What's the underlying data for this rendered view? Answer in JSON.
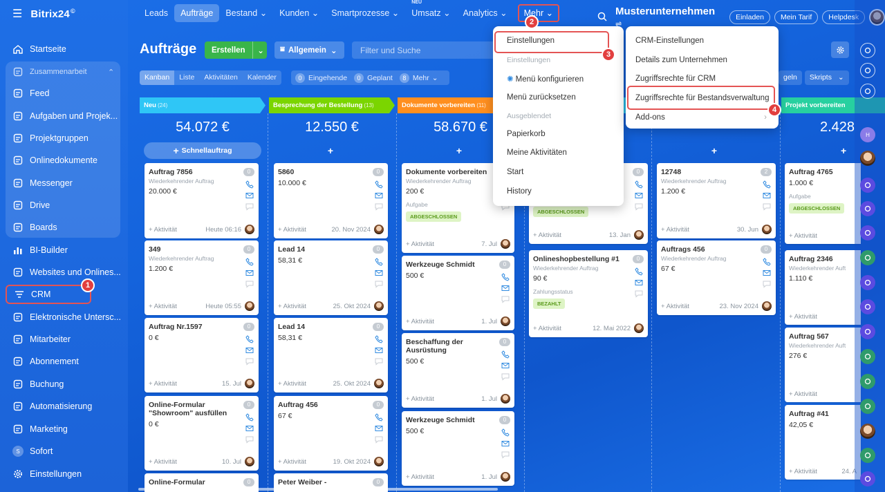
{
  "app": {
    "logo": "Bitrix24",
    "logo_mark": "©"
  },
  "sidebar": {
    "items": [
      {
        "label": "Startseite",
        "icon": "home-icon"
      },
      {
        "label": "Zusammenarbeit",
        "icon": "collab-icon"
      },
      {
        "label": "Feed",
        "icon": "feed-icon"
      },
      {
        "label": "Aufgaben und Projek...",
        "icon": "tasks-icon"
      },
      {
        "label": "Projektgruppen",
        "icon": "groups-icon"
      },
      {
        "label": "Onlinedokumente",
        "icon": "document-icon"
      },
      {
        "label": "Messenger",
        "icon": "chat-icon"
      },
      {
        "label": "Drive",
        "icon": "drive-icon"
      },
      {
        "label": "Boards",
        "icon": "boards-icon"
      },
      {
        "label": "BI-Builder",
        "icon": "chart-icon"
      },
      {
        "label": "Websites und Onlines...",
        "icon": "globe-icon"
      },
      {
        "label": "CRM",
        "icon": "crm-icon"
      },
      {
        "label": "Elektronische Untersc...",
        "icon": "signature-icon"
      },
      {
        "label": "Mitarbeiter",
        "icon": "employees-icon"
      },
      {
        "label": "Abonnement",
        "icon": "subscription-icon"
      },
      {
        "label": "Buchung",
        "icon": "calendar-icon"
      },
      {
        "label": "Automatisierung",
        "icon": "automation-icon"
      },
      {
        "label": "Marketing",
        "icon": "marketing-icon"
      },
      {
        "label": "Sofort",
        "icon": "sofort-icon",
        "icon_letter": "S"
      },
      {
        "label": "Einstellungen",
        "icon": "gear-icon"
      }
    ]
  },
  "topnav": {
    "items": [
      "Leads",
      "Aufträge",
      "Bestand",
      "Kunden",
      "Smartprozesse",
      "Umsatz",
      "Analytics"
    ],
    "new_badge": "NEU",
    "mehr": "Mehr",
    "company": "Musterunternehmen",
    "invite": "Einladen",
    "tariff": "Mein Tarif",
    "helpdesk": "Helpdesk"
  },
  "toolbar": {
    "title": "Aufträge",
    "create": "Erstellen",
    "category": "Allgemein",
    "filter_placeholder": "Filter und Suche"
  },
  "viewbar": {
    "views": [
      "Kanban",
      "Liste",
      "Aktivitäten",
      "Kalender"
    ],
    "counters": [
      {
        "n": "0",
        "label": "Eingehende"
      },
      {
        "n": "0",
        "label": "Geplant"
      },
      {
        "n": "8",
        "label": "Mehr"
      }
    ],
    "right_partial": "geln",
    "scripts": "Skripts"
  },
  "columns": [
    {
      "name": "Neu",
      "count": "(24)",
      "sum": "54.072 €",
      "add": "Schnellauftrag",
      "color": "#2fc6f6"
    },
    {
      "name": "Besprechung der Bestellung",
      "count": "(13)",
      "sum": "12.550 €",
      "color": "#7bd500"
    },
    {
      "name": "Dokumente vorbereiten",
      "count": "(11)",
      "sum": "58.670 €",
      "color": "#ff8f1f"
    },
    {
      "name": "",
      "count": "",
      "sum": "",
      "color": "#2fc6f6"
    },
    {
      "name": "",
      "count": "",
      "sum": "",
      "color": "#2fc6f6"
    },
    {
      "name": "Projekt vorbereiten",
      "count": "",
      "sum": "2.428",
      "color": "#27d0a0"
    }
  ],
  "cards": [
    {
      "title": "Auftrag 7856",
      "sub": "Wiederkehrender Auftrag",
      "amount": "20.000 €",
      "foot": "+ Aktivität",
      "date": "Heute 06:16",
      "n": "0"
    },
    {
      "title": "349",
      "sub": "Wiederkehrender Auftrag",
      "amount": "1.200 €",
      "foot": "+ Aktivität",
      "date": "Heute 05:55",
      "n": "0"
    },
    {
      "title": "Auftrag Nr.1597",
      "sub": "",
      "amount": "0 €",
      "foot": "+ Aktivität",
      "date": "15. Jul",
      "n": "0"
    },
    {
      "title": "Online-Formular \"Showroom\" ausfüllen",
      "sub": "",
      "amount": "0 €",
      "foot": "+ Aktivität",
      "date": "10. Jul",
      "n": "0"
    },
    {
      "title": "Online-Formular",
      "sub": "",
      "amount": "",
      "foot": "",
      "date": "",
      "n": "0"
    },
    {
      "title": "5860",
      "sub": "",
      "amount": "10.000 €",
      "foot": "+ Aktivität",
      "date": "20. Nov 2024",
      "n": "0"
    },
    {
      "title": "Lead 14",
      "sub": "",
      "amount": "58,31 €",
      "foot": "+ Aktivität",
      "date": "25. Okt 2024",
      "n": "0"
    },
    {
      "title": "Lead 14",
      "sub": "",
      "amount": "58,31 €",
      "foot": "+ Aktivität",
      "date": "25. Okt 2024",
      "n": "0"
    },
    {
      "title": "Auftrag 456",
      "sub": "",
      "amount": "67 €",
      "foot": "+ Aktivität",
      "date": "19. Okt 2024",
      "n": "0"
    },
    {
      "title": "Peter Weiber -",
      "sub": "",
      "amount": "",
      "foot": "",
      "date": "",
      "n": "0"
    },
    {
      "title": "Dokumente vorbereiten",
      "sub": "Wiederkehrender Auftrag",
      "amount": "200 €",
      "task": "Aufgabe",
      "tag": "ABGESCHLOSSEN",
      "foot": "+ Aktivität",
      "date": "7. Jul",
      "n": "0"
    },
    {
      "title": "Werkzeuge Schmidt",
      "sub": "",
      "amount": "500 €",
      "foot": "+ Aktivität",
      "date": "1. Jul",
      "n": "0"
    },
    {
      "title": "Beschaffung der Ausrüstung",
      "sub": "",
      "amount": "500 €",
      "foot": "+ Aktivität",
      "date": "1. Jul",
      "n": "0"
    },
    {
      "title": "Werkzeuge Schmidt",
      "sub": "",
      "amount": "500 €",
      "foot": "+ Aktivität",
      "date": "1. Jul",
      "n": "0"
    },
    {
      "title": "",
      "sub": "",
      "amount": "",
      "tag": "ABGESCHLOSSEN",
      "foot": "+ Aktivität",
      "date": "13. Jan",
      "n": "0"
    },
    {
      "title": "Onlineshopbestellung #1",
      "sub": "Wiederkehrender Auftrag",
      "amount": "90 €",
      "task": "Zahlungsstatus",
      "tag": "BEZAHLT",
      "foot": "+ Aktivität",
      "date": "12. Mai 2022",
      "n": "0"
    },
    {
      "title": "12748",
      "sub": "Wiederkehrender Auftrag",
      "amount": "1.200 €",
      "foot": "+ Aktivität",
      "date": "30. Jun",
      "n": "2"
    },
    {
      "title": "Auftrags 456",
      "sub": "Wiederkehrender Auftrag",
      "amount": "67 €",
      "foot": "+ Aktivität",
      "date": "23. Nov 2024",
      "n": "0"
    },
    {
      "title": "Auftrag 4765",
      "sub": "",
      "amount": "1.000 €",
      "task": "Aufgabe",
      "tag": "ABGESCHLOSSEN",
      "foot": "+ Aktivität",
      "date": "",
      "n": ""
    },
    {
      "title": "Auftrag 2346",
      "sub": "Wiederkehrender Auft",
      "amount": "1.110 €",
      "foot": "+ Aktivität",
      "date": "",
      "n": ""
    },
    {
      "title": "Auftrag 567",
      "sub": "Wiederkehrender Auft",
      "amount": "276 €",
      "foot": "+ Aktivität",
      "date": "",
      "n": ""
    },
    {
      "title": "Auftrag #41",
      "sub": "",
      "amount": "42,05 €",
      "foot": "+ Aktivität",
      "date": "24. A",
      "n": ""
    }
  ],
  "mehr_menu": {
    "items": [
      "Einstellungen",
      "Einstellungen",
      "Menü konfigurieren",
      "Menü zurücksetzen",
      "Ausgeblendet",
      "Papierkorb",
      "Meine Aktivitäten",
      "Start",
      "History"
    ]
  },
  "settings_menu": {
    "items": [
      "CRM-Einstellungen",
      "Details zum Unternehmen",
      "Zugriffsrechte für CRM",
      "Zugriffsrechte für Bestandsverwaltung",
      "Add-ons"
    ]
  },
  "step_badges": [
    "1",
    "2",
    "3",
    "4"
  ],
  "colors": {
    "highlight": "#e45454",
    "create_green": "#39b54a",
    "tag_green": "#def4c5"
  }
}
